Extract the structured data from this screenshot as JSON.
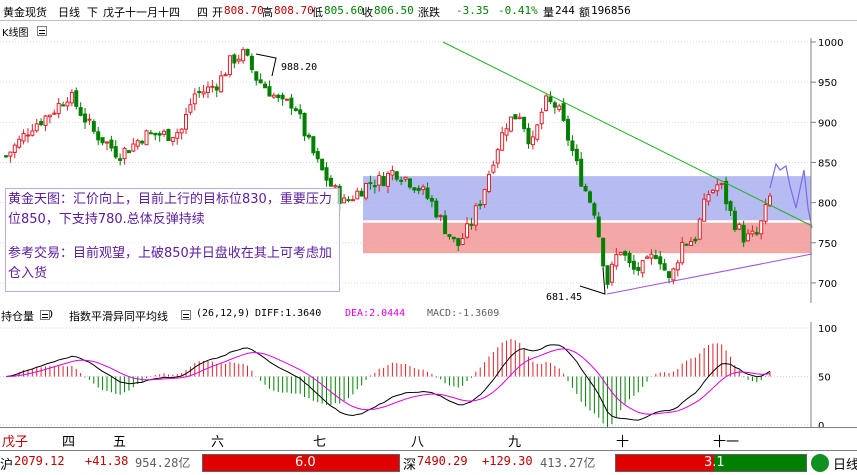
{
  "header": {
    "name": "黄金现货",
    "period": "日线",
    "direction": "下",
    "date": "戊子十一月十四",
    "weekday": "四",
    "open_label": "开",
    "open": "808.70",
    "high_label": "高",
    "high": "808.70",
    "low_label": "低",
    "low": "805.60",
    "close_label": "收",
    "close": "806.50",
    "change_label": "涨跌",
    "change": "-3.35",
    "change_pct": "-0.41%",
    "volume_label": "量",
    "volume": "244",
    "amount_label": "额",
    "amount": "196856"
  },
  "chart_title": "K线图",
  "price_axis": [
    "1000",
    "950",
    "900",
    "850",
    "800",
    "750",
    "700"
  ],
  "annotations": {
    "high_mark": "988.20",
    "low_mark": "681.45",
    "note_line1": "黄金天图：汇价向上，目前上行的目标位830，重要压力位850，下支持780.总体反弹持续",
    "note_line2": "参考交易：目前观望，上破850并日盘收在其上可考虑加仓入货"
  },
  "indicator_bar": {
    "name": "持仓量",
    "value": "0",
    "macd_title": "指数平滑异同平均线",
    "params": "(26,12,9)",
    "diff": "DIFF:1.3640",
    "dea": "DEA:2.0444",
    "macd": "MACD:-1.3609"
  },
  "macd_axis": [
    "100",
    "50",
    "0"
  ],
  "months": [
    "戊子",
    "四",
    "五",
    "六",
    "七",
    "八",
    "九",
    "十",
    "十一"
  ],
  "status": {
    "sh_label": "沪",
    "sh_index": "2079.12",
    "sh_change": "+41.38",
    "sh_amount": "954.28亿",
    "sh_ratio": "6.0",
    "sz_label": "深",
    "sz_index": "7490.29",
    "sz_change": "+129.30",
    "sz_amount": "413.27亿",
    "sz_ratio": "3.1",
    "right_label": "日线"
  },
  "colors": {
    "up": "#e0202a",
    "down": "#008000",
    "resist_band": "#9ea4ee",
    "support_band": "#f08a8a",
    "trend_green": "#22b022",
    "trend_purple": "#9a52e0",
    "dea": "#e000e0",
    "diff": "#000000"
  },
  "chart_data": {
    "type": "candlestick",
    "price_ticks": [
      700,
      750,
      800,
      850,
      900,
      950,
      1000
    ],
    "ylim": [
      675,
      1005
    ],
    "macd_ticks": [
      0,
      50,
      100
    ],
    "macd_ylim": [
      0,
      100
    ],
    "month_labels": [
      "戊子",
      "四",
      "五",
      "六",
      "七",
      "八",
      "九",
      "十",
      "十一"
    ],
    "resist_band": [
      778,
      833
    ],
    "support_band": [
      737,
      775
    ],
    "marked_high": 988.2,
    "marked_low": 681.45,
    "close_path": [
      858,
      875,
      895,
      905,
      918,
      935,
      912,
      888,
      875,
      860,
      870,
      884,
      885,
      885,
      890,
      935,
      940,
      950,
      978,
      985,
      955,
      940,
      922,
      925,
      880,
      845,
      820,
      800,
      812,
      825,
      828,
      840,
      830,
      818,
      800,
      770,
      745,
      770,
      808,
      860,
      900,
      912,
      870,
      925,
      920,
      875,
      825,
      790,
      700,
      745,
      715,
      720,
      740,
      700,
      750,
      755,
      810,
      825,
      780,
      755,
      760,
      806
    ]
  }
}
